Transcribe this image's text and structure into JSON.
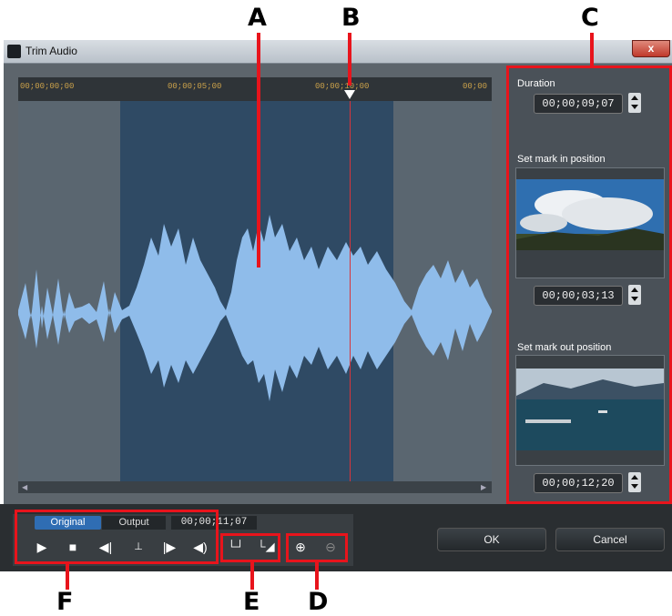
{
  "callouts": {
    "a": "A",
    "b": "B",
    "c": "C",
    "d": "D",
    "e": "E",
    "f": "F"
  },
  "window": {
    "title": "Trim Audio",
    "close_label": "x"
  },
  "ruler": {
    "ticks": [
      "00;00;00;00",
      "00;00;05;00",
      "00;00;10;00",
      "00;00"
    ]
  },
  "side_panel": {
    "duration_label": "Duration",
    "duration_value": "00;00;09;07",
    "mark_in_label": "Set mark in position",
    "mark_in_value": "00;00;03;13",
    "mark_out_label": "Set mark out position",
    "mark_out_value": "00;00;12;20"
  },
  "controls": {
    "tab_original": "Original",
    "tab_output": "Output",
    "current_time": "00;00;11;07",
    "icons": [
      "play-icon",
      "stop-icon",
      "previous-frame-icon",
      "mark-icon",
      "next-frame-icon",
      "volume-icon",
      "mark-in-icon",
      "mark-out-icon",
      "zoom-in-icon",
      "zoom-out-icon"
    ]
  },
  "dialog": {
    "ok_label": "OK",
    "cancel_label": "Cancel"
  },
  "colors": {
    "accent": "#2f6db3",
    "callout_red": "#e8141c",
    "waveform": "#8fbcea"
  }
}
